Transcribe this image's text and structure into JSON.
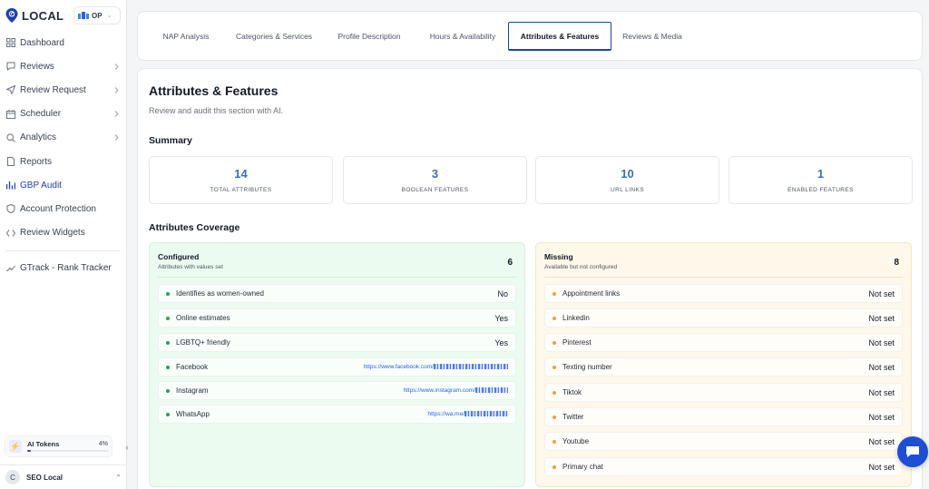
{
  "brand": {
    "name": "LOCAL",
    "workspace": "OP"
  },
  "sidebar": {
    "items": [
      {
        "label": "Dashboard",
        "icon": "grid-icon",
        "chevron": false
      },
      {
        "label": "Reviews",
        "icon": "chat-icon",
        "chevron": true
      },
      {
        "label": "Review Request",
        "icon": "send-icon",
        "chevron": true
      },
      {
        "label": "Scheduler",
        "icon": "calendar-icon",
        "chevron": true
      },
      {
        "label": "Analytics",
        "icon": "search-icon",
        "chevron": true
      },
      {
        "label": "Reports",
        "icon": "document-icon",
        "chevron": false
      },
      {
        "label": "GBP Audit",
        "icon": "audit-icon",
        "chevron": false,
        "active": true
      },
      {
        "label": "Account Protection",
        "icon": "shield-icon",
        "chevron": false
      },
      {
        "label": "Review Widgets",
        "icon": "code-icon",
        "chevron": false
      }
    ],
    "extra_item": {
      "label": "GTrack - Rank Tracker",
      "icon": "trend-icon"
    },
    "tokens": {
      "label": "AI Tokens",
      "percent_text": "4%",
      "percent": 4
    },
    "user": {
      "initial": "C",
      "name": "SEO Local"
    }
  },
  "tabs": [
    {
      "label": "NAP Analysis"
    },
    {
      "label": "Categories & Services"
    },
    {
      "label": "Profile Description"
    },
    {
      "label": "Hours & Availability"
    },
    {
      "label": "Attributes & Features",
      "active": true
    },
    {
      "label": "Reviews & Media"
    }
  ],
  "main": {
    "title": "Attributes & Features",
    "subtitle": "Review and audit this section with AI.",
    "summary_heading": "Summary",
    "stats": [
      {
        "value": "14",
        "label": "TOTAL ATTRIBUTES"
      },
      {
        "value": "3",
        "label": "BOOLEAN FEATURES"
      },
      {
        "value": "10",
        "label": "URL LINKS"
      },
      {
        "value": "1",
        "label": "ENABLED FEATURES"
      }
    ],
    "coverage_heading": "Attributes Coverage",
    "configured": {
      "title": "Configured",
      "subtitle": "Attributes with values set",
      "count": "6",
      "rows": [
        {
          "label": "Identifies as women-owned",
          "value": "No"
        },
        {
          "label": "Online estimates",
          "value": "Yes"
        },
        {
          "label": "LGBTQ+ friendly",
          "value": "Yes"
        },
        {
          "label": "Facebook",
          "url": "https://www.facebook.com/"
        },
        {
          "label": "Instagram",
          "url": "https://www.instagram.com/"
        },
        {
          "label": "WhatsApp",
          "url": "https://wa.me/"
        }
      ]
    },
    "missing": {
      "title": "Missing",
      "subtitle": "Available but not configured",
      "count": "8",
      "rows": [
        {
          "label": "Appointment links",
          "value": "Not set"
        },
        {
          "label": "Linkedin",
          "value": "Not set"
        },
        {
          "label": "Pinterest",
          "value": "Not set"
        },
        {
          "label": "Texting number",
          "value": "Not set"
        },
        {
          "label": "Tiktok",
          "value": "Not set"
        },
        {
          "label": "Twitter",
          "value": "Not set"
        },
        {
          "label": "Youtube",
          "value": "Not set"
        },
        {
          "label": "Primary chat",
          "value": "Not set"
        }
      ]
    }
  },
  "colors": {
    "accent": "#1e40af",
    "stat_value": "#3b6fb6",
    "configured_bg": "#ecfbef",
    "missing_bg": "#fdf8ea"
  }
}
